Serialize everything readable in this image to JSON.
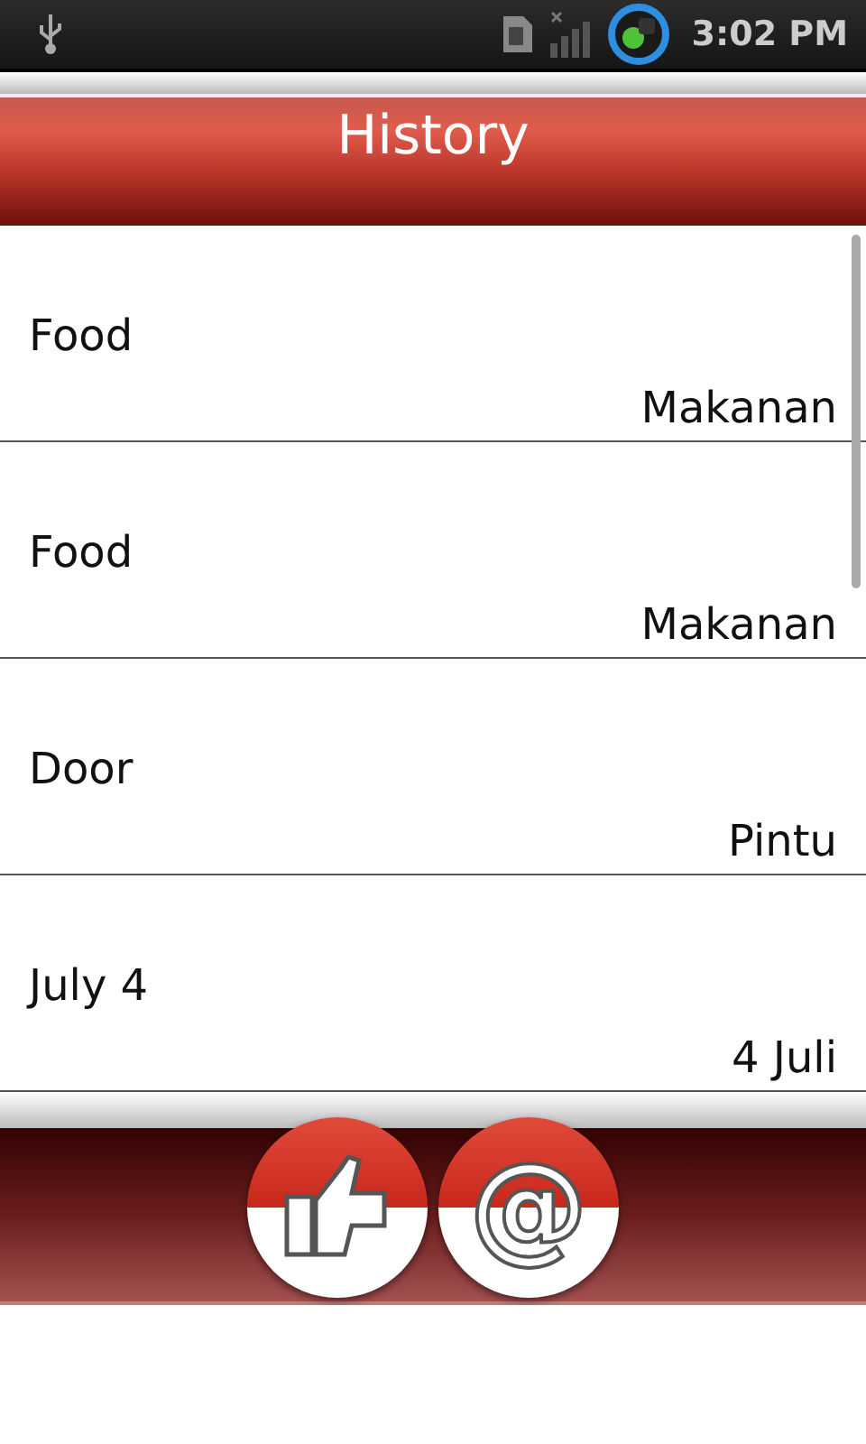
{
  "status_bar": {
    "time": "3:02 PM"
  },
  "title": "History",
  "history": [
    {
      "source": "Food",
      "translation": "Makanan"
    },
    {
      "source": "Food",
      "translation": "Makanan"
    },
    {
      "source": "Door",
      "translation": "Pintu"
    },
    {
      "source": "July 4",
      "translation": "4 Juli"
    }
  ],
  "footer": {
    "email_symbol": "@"
  }
}
